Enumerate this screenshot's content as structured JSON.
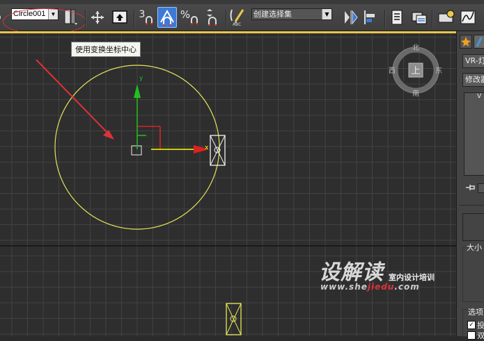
{
  "toolbar": {
    "selection_name": "Circle001",
    "spinner_snap_label": "3",
    "percent_snap_label": "%",
    "named_selection_set": "创建选择集",
    "abc_label": "ABC"
  },
  "tooltip": {
    "text": "使用变换坐标中心"
  },
  "viewcube": {
    "north": "北",
    "south": "南",
    "east": "东",
    "west": "西",
    "face": "上"
  },
  "gizmo": {
    "x_axis": "x",
    "y_axis": "y"
  },
  "command_panel": {
    "object_name": "VR-灯",
    "modifier_list": "修改器",
    "list_header": "V",
    "size_label": "大小",
    "options_label": "选项",
    "checkbox_1_label": "投",
    "checkbox_2_label": "双"
  },
  "watermark": {
    "brand": "设解读",
    "subtitle": "室内设计培训",
    "url_prefix": "www.she",
    "url_highlight": "jiedu",
    "url_suffix": ".com"
  },
  "colors": {
    "viewport_bg": "#2e2e2e",
    "grid": "#424242",
    "active_border": "#e8c84a",
    "circle": "#e6e65a",
    "annotation_red": "#e0303a",
    "axis_x": "#ff2020",
    "axis_y": "#20c020",
    "axis_arrow": "#ffff00",
    "tool_active": "#3d7ad6"
  }
}
